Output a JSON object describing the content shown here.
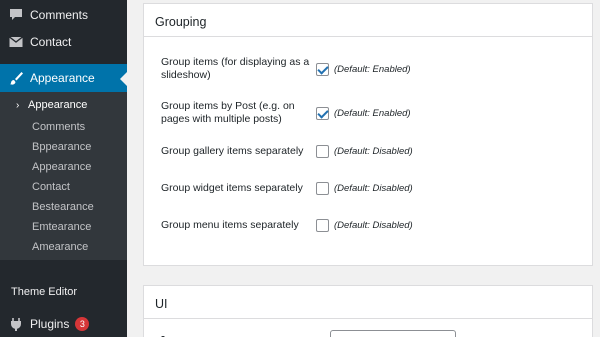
{
  "sidebar": {
    "comments": "Comments",
    "contact": "Contact",
    "appearance": "Appearance",
    "submenu": [
      "Appearance",
      "Comments",
      "Bppearance",
      "Appearance",
      "Contact",
      "Bestearance",
      "Emtearance",
      "Amearance"
    ],
    "theme_editor": "Theme Editor",
    "plugins": "Plugins",
    "plugins_count": "3"
  },
  "grouping": {
    "title": "Grouping",
    "rows": [
      {
        "label": "Group items (for displaying as a slideshow)",
        "checked": true,
        "default": "(Default: Enabled)"
      },
      {
        "label": "Group items by Post (e.g. on pages with multiple posts)",
        "checked": true,
        "default": "(Default: Enabled)"
      },
      {
        "label": "Group gallery items separately",
        "checked": false,
        "default": "(Default: Disabled)"
      },
      {
        "label": "Group widget items separately",
        "checked": false,
        "default": "(Default: Disabled)"
      },
      {
        "label": "Group menu items separately",
        "checked": false,
        "default": "(Default: Disabled)"
      }
    ]
  },
  "ui": {
    "title": "UI"
  },
  "colors": {
    "sidebar_bg": "#23282d",
    "submenu_bg": "#32373c",
    "accent": "#0073aa",
    "badge": "#d63638"
  }
}
